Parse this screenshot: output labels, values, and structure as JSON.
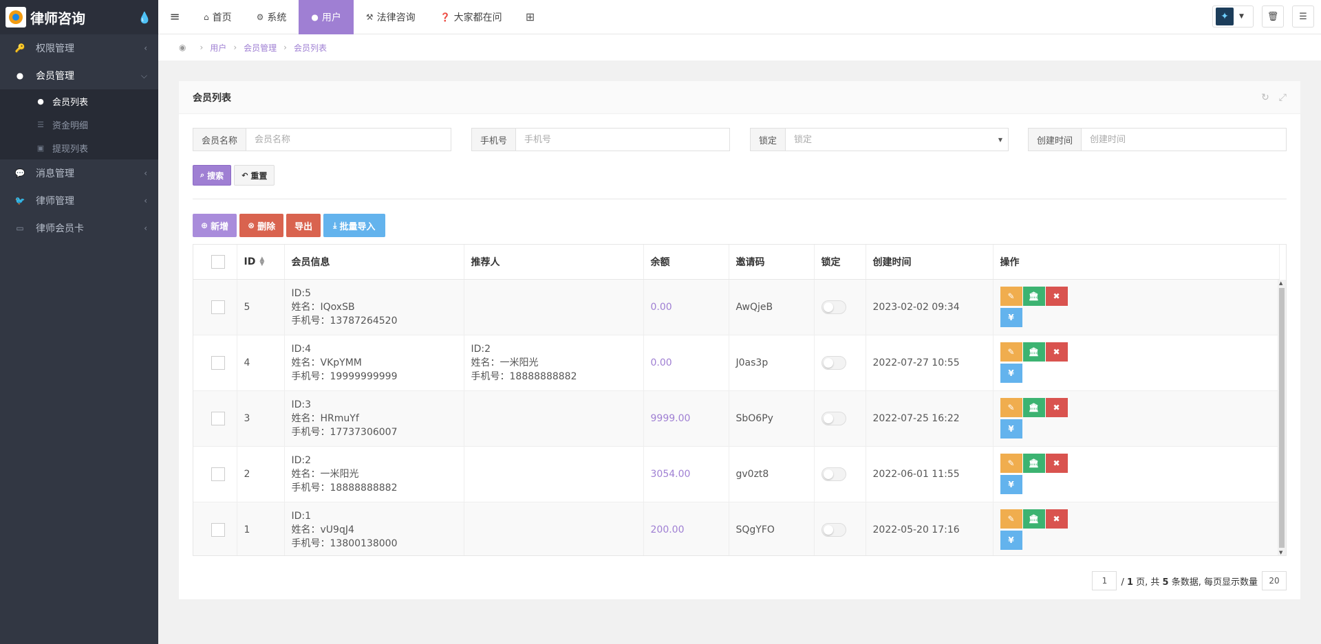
{
  "app": {
    "title": "律师咨询"
  },
  "sidebar": {
    "items": [
      {
        "label": "权限管理",
        "icon": "key-icon"
      },
      {
        "label": "会员管理",
        "icon": "user-icon",
        "open": true,
        "children": [
          {
            "label": "会员列表",
            "icon": "user-icon",
            "active": true
          },
          {
            "label": "资金明细",
            "icon": "list-icon"
          },
          {
            "label": "提现列表",
            "icon": "money-icon"
          }
        ]
      },
      {
        "label": "消息管理",
        "icon": "comments-icon"
      },
      {
        "label": "律师管理",
        "icon": "twitter-icon"
      },
      {
        "label": "律师会员卡",
        "icon": "credit-card-icon"
      }
    ]
  },
  "topnav": {
    "tabs": [
      {
        "label": "首页",
        "icon": "home-icon"
      },
      {
        "label": "系统",
        "icon": "gear-icon"
      },
      {
        "label": "用户",
        "icon": "user-icon",
        "active": true
      },
      {
        "label": "法律咨询",
        "icon": "gavel-icon"
      },
      {
        "label": "大家都在问",
        "icon": "question-icon"
      }
    ]
  },
  "breadcrumb": [
    "用户",
    "会员管理",
    "会员列表"
  ],
  "panel": {
    "title": "会员列表"
  },
  "filters": [
    {
      "label": "会员名称",
      "placeholder": "会员名称"
    },
    {
      "label": "手机号",
      "placeholder": "手机号"
    },
    {
      "label": "锁定",
      "placeholder": "锁定"
    },
    {
      "label": "创建时间",
      "placeholder": "创建时间"
    }
  ],
  "search": {
    "search_label": "搜索",
    "reset_label": "重置"
  },
  "actions": {
    "add": "新增",
    "delete": "删除",
    "export": "导出",
    "import": "批量导入"
  },
  "table": {
    "headers": [
      "ID",
      "会员信息",
      "推荐人",
      "余额",
      "邀请码",
      "锁定",
      "创建时间",
      "操作"
    ],
    "rows": [
      {
        "id": "5",
        "info": [
          "ID:5",
          "姓名：IQoxSB",
          "手机号：13787264520"
        ],
        "referrer": [],
        "balance": "0.00",
        "code": "AwQjeB",
        "locked": false,
        "created": "2023-02-02 09:34"
      },
      {
        "id": "4",
        "info": [
          "ID:4",
          "姓名：VKpYMM",
          "手机号：19999999999"
        ],
        "referrer": [
          "ID:2",
          "姓名：一米阳光",
          "手机号：18888888882"
        ],
        "balance": "0.00",
        "code": "J0as3p",
        "locked": false,
        "created": "2022-07-27 10:55"
      },
      {
        "id": "3",
        "info": [
          "ID:3",
          "姓名：HRmuYf",
          "手机号：17737306007"
        ],
        "referrer": [],
        "balance": "9999.00",
        "code": "SbO6Py",
        "locked": false,
        "created": "2022-07-25 16:22"
      },
      {
        "id": "2",
        "info": [
          "ID:2",
          "姓名：一米阳光",
          "手机号：18888888882"
        ],
        "referrer": [],
        "balance": "3054.00",
        "code": "gv0zt8",
        "locked": false,
        "created": "2022-06-01 11:55"
      },
      {
        "id": "1",
        "info": [
          "ID:1",
          "姓名：vU9qJ4",
          "手机号：13800138000"
        ],
        "referrer": [],
        "balance": "200.00",
        "code": "SQgYFO",
        "locked": false,
        "created": "2022-05-20 17:16"
      }
    ]
  },
  "pagination": {
    "page": "1",
    "total_pages": "1",
    "total": "5",
    "page_size": "20"
  }
}
